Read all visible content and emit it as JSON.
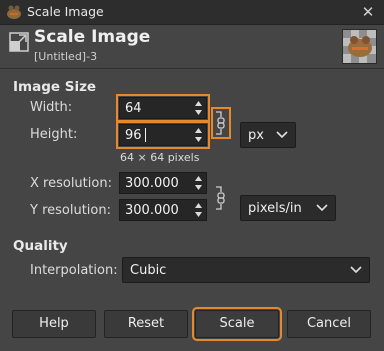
{
  "window": {
    "title": "Scale Image"
  },
  "header": {
    "title": "Scale Image",
    "subtitle": "[Untitled]-3"
  },
  "image_size": {
    "section_label": "Image Size",
    "width_label": "Width:",
    "width_value": "64",
    "height_label": "Height:",
    "height_value": "96",
    "pixel_summary": "64 × 64 pixels",
    "unit_value": "px",
    "x_res_label": "X resolution:",
    "x_res_value": "300.000",
    "y_res_label": "Y resolution:",
    "y_res_value": "300.000",
    "res_unit_value": "pixels/in"
  },
  "quality": {
    "section_label": "Quality",
    "interp_label": "Interpolation:",
    "interp_value": "Cubic"
  },
  "buttons": {
    "help": "Help",
    "reset": "Reset",
    "scale": "Scale",
    "cancel": "Cancel"
  },
  "colors": {
    "accent": "#e58a2c",
    "background": "#454545",
    "field": "#262626"
  },
  "icons": [
    "gimp-logo-icon",
    "close-icon",
    "scale-image-icon",
    "image-thumbnail",
    "chain-link-icon",
    "chevron-down-icon",
    "spin-arrows-icon"
  ]
}
